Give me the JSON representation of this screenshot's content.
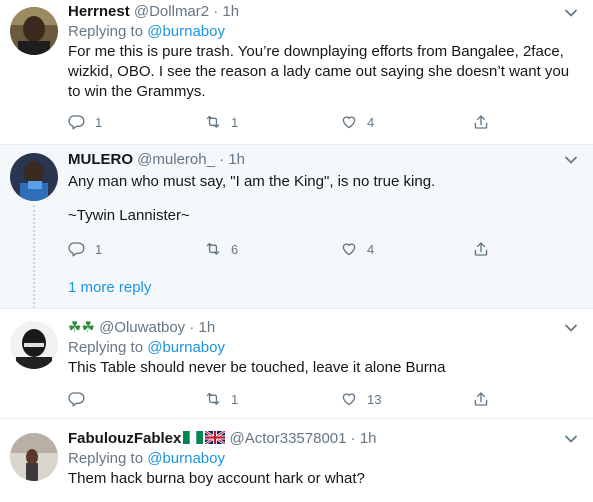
{
  "tweets": [
    {
      "name": "Herrnest",
      "handle": "@Dollmar2",
      "time": "· 1h",
      "replying_prefix": "Replying to",
      "replying_to": "@burnaboy",
      "text_lines": [
        "For me this is pure trash. You’re downplaying efforts from Bangalee, 2face,",
        "wizkid, OBO. I see the reason a lady came out saying she doesn’t want you",
        "to win the Grammys."
      ],
      "replies": "1",
      "retweets": "1",
      "likes": "4"
    },
    {
      "name": "MULERO",
      "handle": "@muleroh_",
      "time": "· 1h",
      "text_lines": [
        "Any man who must say, \"I am the King\", is no true king.",
        "",
        "~Tywin Lannister~"
      ],
      "replies": "1",
      "retweets": "6",
      "likes": "4"
    },
    {
      "name": "☘☘",
      "handle": "@Oluwatboy",
      "time": "· 1h",
      "replying_prefix": "Replying to",
      "replying_to": "@burnaboy",
      "text_lines": [
        "This Table should never be touched, leave it alone Burna"
      ],
      "replies": "",
      "retweets": "1",
      "likes": "13"
    },
    {
      "name": "FabulouzFablex",
      "handle": "@Actor33578001",
      "time": "· 1h",
      "replying_prefix": "Replying to",
      "replying_to": "@burnaboy",
      "text_lines": [
        "Them hack burna boy account hark or what?"
      ]
    }
  ],
  "more_replies": "1 more reply",
  "icons": {
    "reply": "reply-icon",
    "retweet": "retweet-icon",
    "like": "heart-icon",
    "share": "share-icon",
    "menu": "chevron-down-icon"
  },
  "colors": {
    "link": "#1b95e0",
    "secondary": "#657786",
    "border": "#e6ecf0",
    "highlight_bg": "#f5f8fa"
  }
}
